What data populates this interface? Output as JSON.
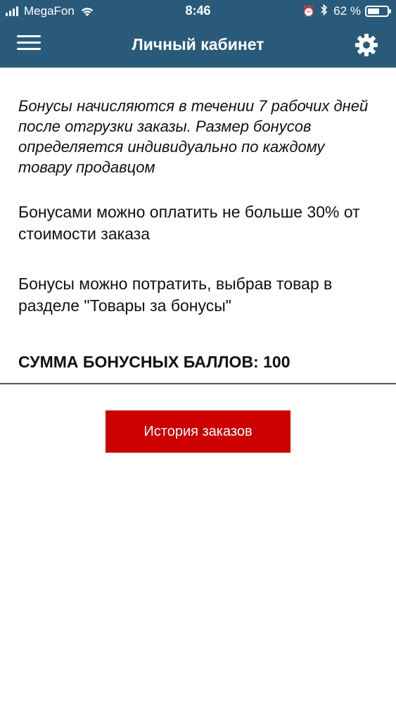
{
  "status_bar": {
    "carrier": "MegaFon",
    "time": "8:46",
    "battery_percent": "62 %",
    "battery_level": 0.62,
    "icons": [
      "signal-bars-icon",
      "wifi-icon",
      "alarm-icon",
      "bluetooth-icon",
      "battery-icon"
    ]
  },
  "header": {
    "title": "Личный кабинет",
    "menu_icon": "hamburger-menu-icon",
    "settings_icon": "gear-icon"
  },
  "main": {
    "paragraph_1": "Бонусы начисляются в течении 7 рабочих дней после отгрузки заказы. Размер бонусов определяется индивидуально по каждому товару продавцом",
    "paragraph_2": "Бонусами можно оплатить не больше 30% от стоимости заказа",
    "paragraph_3": "Бонусы можно потратить, выбрав товар в разделе \"Товары за бонусы\"",
    "bonus_sum": "СУММА БОНУСНЫХ БАЛЛОВ: 100",
    "history_button": "История заказов"
  },
  "colors": {
    "header_bg": "#2a5a7a",
    "button_bg": "#cc0000",
    "text": "#111111"
  }
}
